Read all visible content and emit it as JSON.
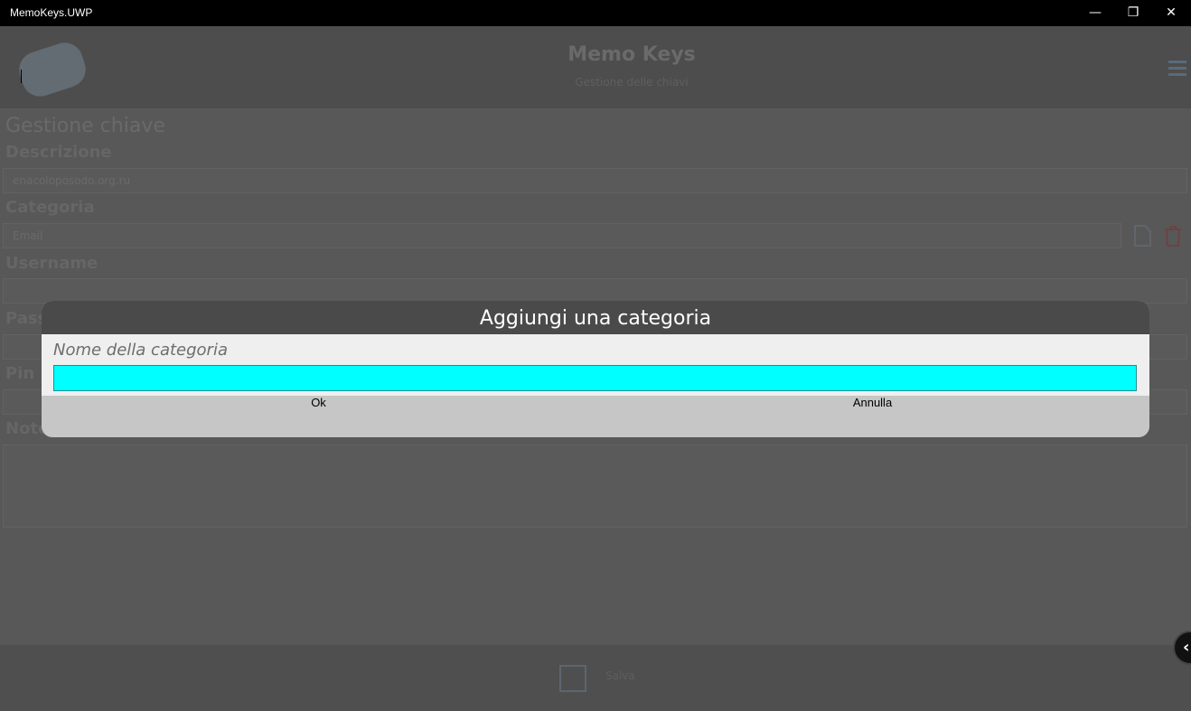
{
  "window": {
    "title": "MemoKeys.UWP",
    "minimize_glyph": "—",
    "restore_glyph": "❐",
    "close_glyph": "✕"
  },
  "header": {
    "app_title": "Memo Keys",
    "app_subtitle": "Gestione delle chiavi",
    "logo_icon": "keys-logo-icon",
    "menu_icon": "hamburger-menu-icon"
  },
  "form": {
    "page_title": "Gestione chiave",
    "descrizione_label": "Descrizione",
    "descrizione_value": "enacoloposodo.org.ru",
    "categoria_label": "Categoria",
    "categoria_value": "Email",
    "username_label": "Username",
    "password_label": "Pass",
    "pin_label": "Pin",
    "note_label": "Note"
  },
  "footer": {
    "save_label": "Salva",
    "save_icon": "floppy-disk-icon"
  },
  "dialog": {
    "title": "Aggiungi una categoria",
    "field_label": "Nome della categoria",
    "field_value": "",
    "ok_label": "Ok",
    "cancel_label": "Annulla",
    "input_color": "#00FFFF"
  },
  "back_button": {
    "glyph": "‹"
  }
}
